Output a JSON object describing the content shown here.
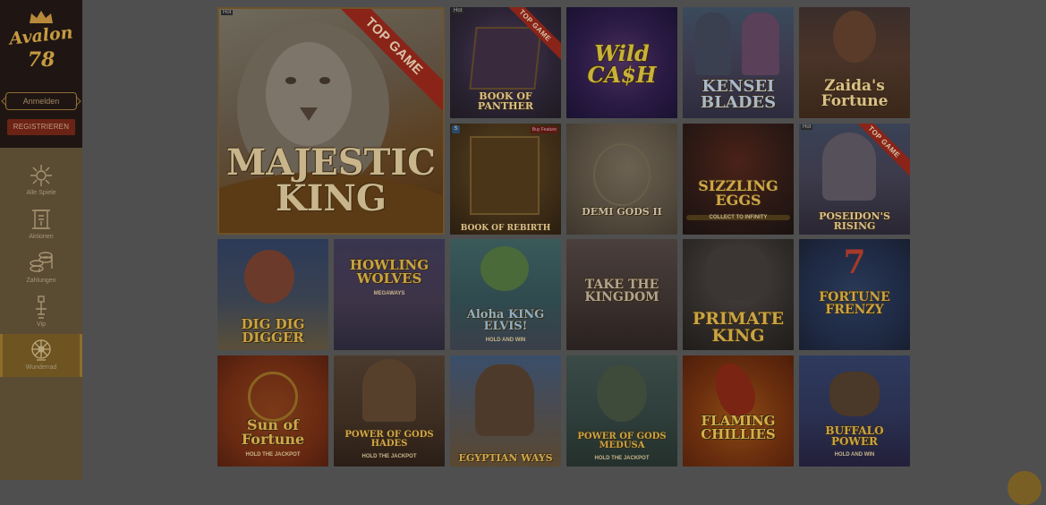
{
  "brand": {
    "name": "Avalon",
    "number": "78"
  },
  "auth": {
    "login_label": "Anmelden",
    "register_label": "REGISTRIEREN"
  },
  "nav": [
    {
      "label": "Alle Spiele",
      "icon": "all-games-icon"
    },
    {
      "label": "Aktionen",
      "icon": "promotions-icon"
    },
    {
      "label": "Zahlungen",
      "icon": "payments-icon"
    },
    {
      "label": "Vip",
      "icon": "vip-icon"
    },
    {
      "label": "Wunderrad",
      "icon": "wheel-icon",
      "active": true
    }
  ],
  "games": {
    "majestic_king": {
      "title": "MAJESTIC KING",
      "hot": "Hot",
      "ribbon": "TOP GAME"
    },
    "book_of_panther": {
      "title": "BOOK OF PANTHER",
      "hot": "Hot",
      "ribbon": "TOP GAME"
    },
    "wild_cash": {
      "title": "Wild CA$H"
    },
    "kensei_blades": {
      "title": "KENSEI BLADES"
    },
    "zaidas_fortune": {
      "title": "Zaida's Fortune"
    },
    "book_of_rebirth": {
      "title": "BOOK OF REBIRTH",
      "badge": "S",
      "tag": "Buy Feature"
    },
    "demi_gods": {
      "title": "DEMI GODS II"
    },
    "sizzling_eggs": {
      "title": "SIZZLING EGGS",
      "subtitle": "COLLECT TO INFINITY"
    },
    "poseidons_rising": {
      "title": "POSEIDON'S RISING",
      "hot": "Hot",
      "ribbon": "TOP GAME"
    },
    "dig_dig_digger": {
      "title": "DIG DIG DIGGER"
    },
    "howling_wolves": {
      "title": "HOWLING WOLVES",
      "subtitle": "MEGAWAYS"
    },
    "aloha_king_elvis": {
      "title": "Aloha KING ELVIS!",
      "subtitle": "HOLD AND WIN"
    },
    "take_the_kingdom": {
      "title": "TAKE THE KINGDOM"
    },
    "primate_king": {
      "title": "PRIMATE KING"
    },
    "fortune_frenzy": {
      "title": "FORTUNE FRENZY"
    },
    "sun_of_fortune": {
      "title": "Sun of Fortune",
      "subtitle": "HOLD THE JACKPOT"
    },
    "power_of_gods_hades": {
      "title": "POWER OF GODS HADES",
      "subtitle": "HOLD THE JACKPOT"
    },
    "egyptian_ways": {
      "title": "EGYPTIAN WAYS"
    },
    "power_of_gods_medusa": {
      "title": "POWER OF GODS MEDUSA",
      "subtitle": "HOLD THE JACKPOT"
    },
    "flaming_chillies": {
      "title": "FLAMING CHILLIES"
    },
    "buffalo_power": {
      "title": "BUFFALO POWER",
      "subtitle": "HOLD AND WIN"
    }
  }
}
